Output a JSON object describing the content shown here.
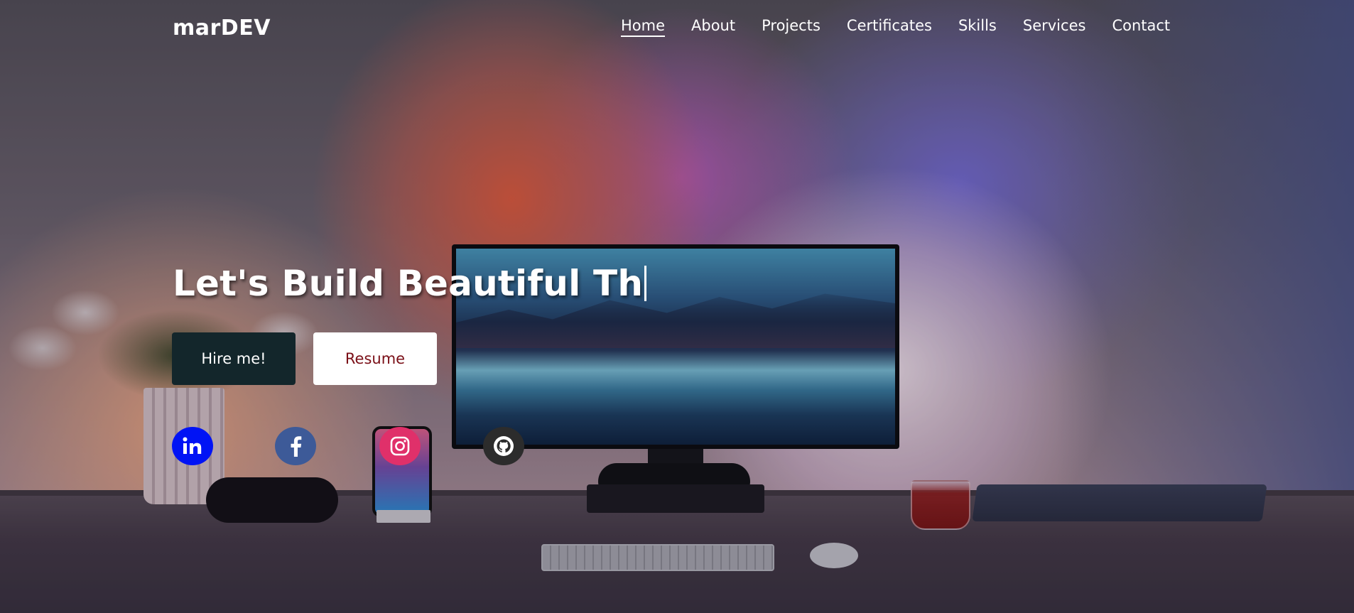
{
  "brand": {
    "name": "marDEV"
  },
  "nav": {
    "items": [
      {
        "label": "Home",
        "active": true
      },
      {
        "label": "About",
        "active": false
      },
      {
        "label": "Projects",
        "active": false
      },
      {
        "label": "Certificates",
        "active": false
      },
      {
        "label": "Skills",
        "active": false
      },
      {
        "label": "Services",
        "active": false
      },
      {
        "label": "Contact",
        "active": false
      }
    ]
  },
  "hero": {
    "typed_text": "Let's Build Beautiful Th",
    "buttons": {
      "hire_label": "Hire me!",
      "resume_label": "Resume"
    }
  },
  "social": {
    "items": [
      {
        "name": "linkedin-icon",
        "color": "#0013f5"
      },
      {
        "name": "facebook-icon",
        "color": "#3d5a98"
      },
      {
        "name": "instagram-icon",
        "color": "#e0306a"
      },
      {
        "name": "github-icon",
        "color": "#2c2c2c"
      }
    ]
  },
  "colors": {
    "hire_button_bg": "#13262b",
    "resume_text": "#7a0f17",
    "text": "#ffffff"
  }
}
